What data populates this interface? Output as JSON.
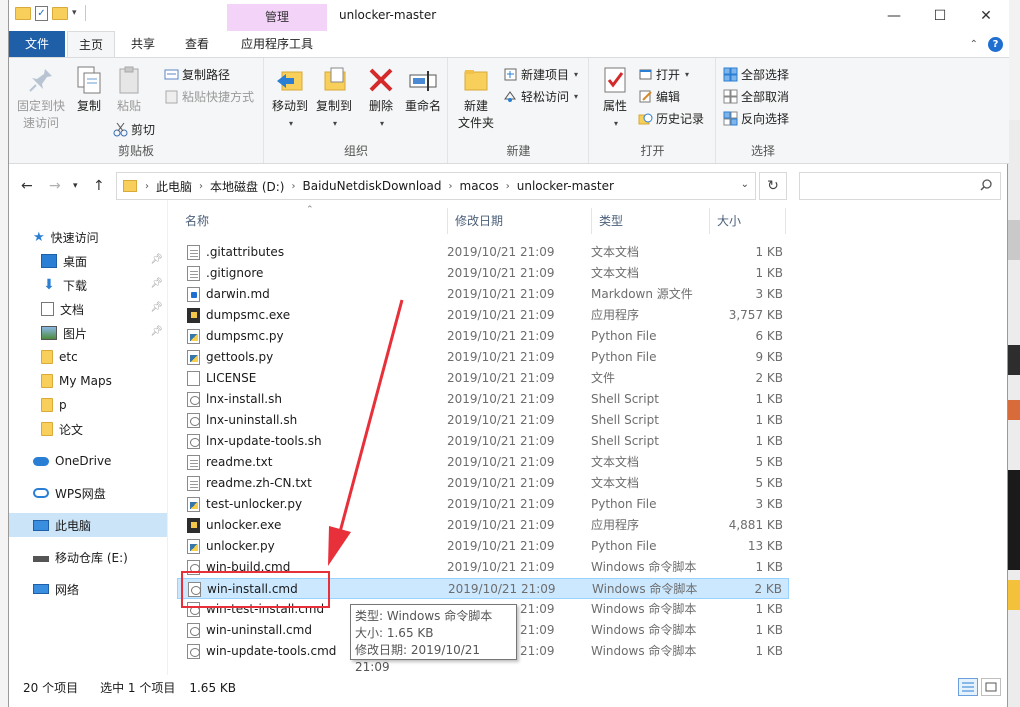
{
  "window": {
    "title": "unlocker-master",
    "manage_tab": "管理",
    "minimize_glyph": "—",
    "maximize_glyph": "☐",
    "close_glyph": "✕"
  },
  "ribbon_tabs": [
    "文件",
    "主页",
    "共享",
    "查看",
    "应用程序工具"
  ],
  "ribbon": {
    "clipboard": {
      "label": "剪贴板",
      "pin_quick": "固定到快\n速访问",
      "copy": "复制",
      "paste": "粘贴",
      "copy_path": "复制路径",
      "paste_shortcut": "粘贴快捷方式",
      "cut": "剪切"
    },
    "organize": {
      "label": "组织",
      "move_to": "移动到",
      "copy_to": "复制到",
      "delete": "删除",
      "rename": "重命名"
    },
    "new": {
      "label": "新建",
      "new_folder": "新建\n文件夹",
      "new_item": "新建项目",
      "easy_access": "轻松访问"
    },
    "open": {
      "label": "打开",
      "properties": "属性",
      "open": "打开",
      "edit": "编辑",
      "history": "历史记录"
    },
    "select": {
      "label": "选择",
      "select_all": "全部选择",
      "select_none": "全部取消",
      "invert": "反向选择"
    }
  },
  "address": {
    "crumbs": [
      "此电脑",
      "本地磁盘 (D:)",
      "BaiduNetdiskDownload",
      "macos",
      "unlocker-master"
    ]
  },
  "nav_pane": [
    {
      "label": "快速访问",
      "icon": "star-icon",
      "pinned": false
    },
    {
      "label": "桌面",
      "icon": "desktop-icon",
      "pinned": true
    },
    {
      "label": "下载",
      "icon": "download-icon",
      "pinned": true
    },
    {
      "label": "文档",
      "icon": "document-icon",
      "pinned": true
    },
    {
      "label": "图片",
      "icon": "picture-icon",
      "pinned": true
    },
    {
      "label": "etc",
      "icon": "folder-icon",
      "pinned": false
    },
    {
      "label": "My Maps",
      "icon": "folder-icon",
      "pinned": false
    },
    {
      "label": "p",
      "icon": "folder-icon",
      "pinned": false
    },
    {
      "label": "论文",
      "icon": "folder-icon",
      "pinned": false
    },
    {
      "label": "OneDrive",
      "icon": "cloud-icon",
      "pinned": false
    },
    {
      "label": "WPS网盘",
      "icon": "wps-cloud-icon",
      "pinned": false
    },
    {
      "label": "此电脑",
      "icon": "computer-icon",
      "pinned": false
    },
    {
      "label": "移动仓库 (E:)",
      "icon": "drive-icon",
      "pinned": false
    },
    {
      "label": "网络",
      "icon": "network-icon",
      "pinned": false
    }
  ],
  "columns": [
    "名称",
    "修改日期",
    "类型",
    "大小"
  ],
  "files": [
    {
      "name": ".gitattributes",
      "date": "2019/10/21 21:09",
      "type": "文本文档",
      "size": "1 KB",
      "icon": "txt"
    },
    {
      "name": ".gitignore",
      "date": "2019/10/21 21:09",
      "type": "文本文档",
      "size": "1 KB",
      "icon": "txt"
    },
    {
      "name": "darwin.md",
      "date": "2019/10/21 21:09",
      "type": "Markdown 源文件",
      "size": "3 KB",
      "icon": "md"
    },
    {
      "name": "dumpsmc.exe",
      "date": "2019/10/21 21:09",
      "type": "应用程序",
      "size": "3,757 KB",
      "icon": "exe"
    },
    {
      "name": "dumpsmc.py",
      "date": "2019/10/21 21:09",
      "type": "Python File",
      "size": "6 KB",
      "icon": "py"
    },
    {
      "name": "gettools.py",
      "date": "2019/10/21 21:09",
      "type": "Python File",
      "size": "9 KB",
      "icon": "py"
    },
    {
      "name": "LICENSE",
      "date": "2019/10/21 21:09",
      "type": "文件",
      "size": "2 KB",
      "icon": "blank"
    },
    {
      "name": "lnx-install.sh",
      "date": "2019/10/21 21:09",
      "type": "Shell Script",
      "size": "1 KB",
      "icon": "cmd"
    },
    {
      "name": "lnx-uninstall.sh",
      "date": "2019/10/21 21:09",
      "type": "Shell Script",
      "size": "1 KB",
      "icon": "cmd"
    },
    {
      "name": "lnx-update-tools.sh",
      "date": "2019/10/21 21:09",
      "type": "Shell Script",
      "size": "1 KB",
      "icon": "cmd"
    },
    {
      "name": "readme.txt",
      "date": "2019/10/21 21:09",
      "type": "文本文档",
      "size": "5 KB",
      "icon": "txt"
    },
    {
      "name": "readme.zh-CN.txt",
      "date": "2019/10/21 21:09",
      "type": "文本文档",
      "size": "5 KB",
      "icon": "txt"
    },
    {
      "name": "test-unlocker.py",
      "date": "2019/10/21 21:09",
      "type": "Python File",
      "size": "3 KB",
      "icon": "py"
    },
    {
      "name": "unlocker.exe",
      "date": "2019/10/21 21:09",
      "type": "应用程序",
      "size": "4,881 KB",
      "icon": "exe"
    },
    {
      "name": "unlocker.py",
      "date": "2019/10/21 21:09",
      "type": "Python File",
      "size": "13 KB",
      "icon": "py"
    },
    {
      "name": "win-build.cmd",
      "date": "2019/10/21 21:09",
      "type": "Windows 命令脚本",
      "size": "1 KB",
      "icon": "cmd"
    },
    {
      "name": "win-install.cmd",
      "date": "2019/10/21 21:09",
      "type": "Windows 命令脚本",
      "size": "2 KB",
      "icon": "cmd",
      "selected": true
    },
    {
      "name": "win-test-install.cmd",
      "date": "2019/10/21 21:09",
      "type": "Windows 命令脚本",
      "size": "1 KB",
      "icon": "cmd"
    },
    {
      "name": "win-uninstall.cmd",
      "date": "2019/10/21 21:09",
      "type": "Windows 命令脚本",
      "size": "1 KB",
      "icon": "cmd"
    },
    {
      "name": "win-update-tools.cmd",
      "date": "2019/10/21 21:09",
      "type": "Windows 命令脚本",
      "size": "1 KB",
      "icon": "cmd"
    }
  ],
  "tooltip": {
    "type_line": "类型: Windows 命令脚本",
    "size_line": "大小: 1.65 KB",
    "date_line": "修改日期: 2019/10/21 21:09"
  },
  "status": {
    "count": "20 个项目",
    "selection": "选中 1 个项目",
    "selection_size": "1.65 KB"
  },
  "colors": {
    "file_tab": "#1f5fa8",
    "manage_tab": "#f3d3f8",
    "selection": "#cce8ff",
    "annotation": "#e8303a"
  }
}
